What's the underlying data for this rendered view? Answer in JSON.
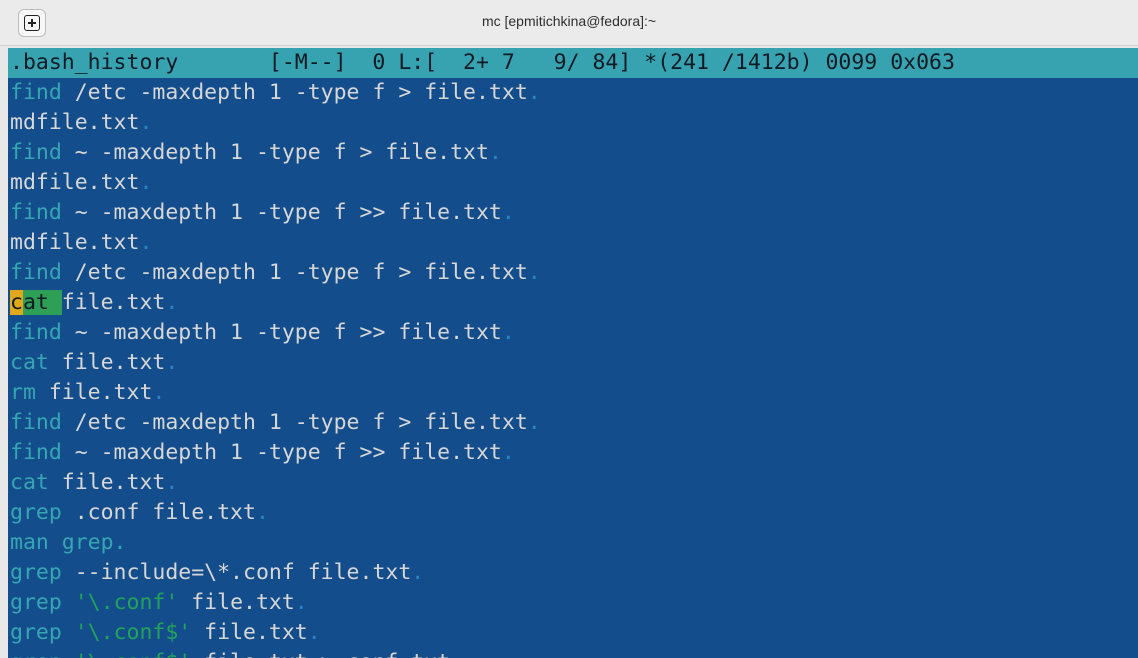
{
  "window": {
    "title": "mc [epmitichkina@fedora]:~",
    "new_tab_icon": "plus-square-icon"
  },
  "editor": {
    "status": ".bash_history       [-M--]  0 L:[  2+ 7   9/ 84] *(241 /1412b) 0099 0x063",
    "lines": [
      [
        {
          "t": "find",
          "c": "kw"
        },
        {
          "t": " /etc -maxdepth 1 -type f > file.txt",
          "c": ""
        },
        {
          "t": ".",
          "c": "eol"
        }
      ],
      [
        {
          "t": "mdfile.txt",
          "c": ""
        },
        {
          "t": ".",
          "c": "eol"
        }
      ],
      [
        {
          "t": "find",
          "c": "kw"
        },
        {
          "t": " ~ -maxdepth 1 -type f > file.txt",
          "c": ""
        },
        {
          "t": ".",
          "c": "eol"
        }
      ],
      [
        {
          "t": "mdfile.txt",
          "c": ""
        },
        {
          "t": ".",
          "c": "eol"
        }
      ],
      [
        {
          "t": "find",
          "c": "kw"
        },
        {
          "t": " ~ -maxdepth 1 -type f >> file.txt",
          "c": ""
        },
        {
          "t": ".",
          "c": "eol"
        }
      ],
      [
        {
          "t": "mdfile.txt",
          "c": ""
        },
        {
          "t": ".",
          "c": "eol"
        }
      ],
      [
        {
          "t": "find",
          "c": "kw"
        },
        {
          "t": " /etc -maxdepth 1 -type f > file.txt",
          "c": ""
        },
        {
          "t": ".",
          "c": "eol"
        }
      ],
      [
        {
          "t": "c",
          "c": "cursor-c"
        },
        {
          "t": "at ",
          "c": "sel"
        },
        {
          "t": "file.txt",
          "c": ""
        },
        {
          "t": ".",
          "c": "eol"
        }
      ],
      [
        {
          "t": "find",
          "c": "kw"
        },
        {
          "t": " ~ -maxdepth 1 -type f >> file.txt",
          "c": ""
        },
        {
          "t": ".",
          "c": "eol"
        }
      ],
      [
        {
          "t": "cat",
          "c": "kw"
        },
        {
          "t": " file.txt",
          "c": ""
        },
        {
          "t": ".",
          "c": "eol"
        }
      ],
      [
        {
          "t": "rm",
          "c": "kw"
        },
        {
          "t": " file.txt",
          "c": ""
        },
        {
          "t": ".",
          "c": "eol"
        }
      ],
      [
        {
          "t": "find",
          "c": "kw"
        },
        {
          "t": " /etc -maxdepth 1 -type f > file.txt",
          "c": ""
        },
        {
          "t": ".",
          "c": "eol"
        }
      ],
      [
        {
          "t": "find",
          "c": "kw"
        },
        {
          "t": " ~ -maxdepth 1 -type f >> file.txt",
          "c": ""
        },
        {
          "t": ".",
          "c": "eol"
        }
      ],
      [
        {
          "t": "cat",
          "c": "kw"
        },
        {
          "t": " file.txt",
          "c": ""
        },
        {
          "t": ".",
          "c": "eol"
        }
      ],
      [
        {
          "t": "grep",
          "c": "kw"
        },
        {
          "t": " .conf file.txt",
          "c": ""
        },
        {
          "t": ".",
          "c": "eol"
        }
      ],
      [
        {
          "t": "man grep.",
          "c": "kw"
        }
      ],
      [
        {
          "t": "grep",
          "c": "kw"
        },
        {
          "t": " --include=\\*.conf file.txt",
          "c": ""
        },
        {
          "t": ".",
          "c": "eol"
        }
      ],
      [
        {
          "t": "grep",
          "c": "kw"
        },
        {
          "t": " ",
          "c": ""
        },
        {
          "t": "'\\.conf'",
          "c": "str"
        },
        {
          "t": " file.txt",
          "c": ""
        },
        {
          "t": ".",
          "c": "eol"
        }
      ],
      [
        {
          "t": "grep",
          "c": "kw"
        },
        {
          "t": " ",
          "c": ""
        },
        {
          "t": "'\\.conf$'",
          "c": "str"
        },
        {
          "t": " file.txt",
          "c": ""
        },
        {
          "t": ".",
          "c": "eol"
        }
      ],
      [
        {
          "t": "grep",
          "c": "kw"
        },
        {
          "t": " ",
          "c": ""
        },
        {
          "t": "'\\.conf$'",
          "c": "str"
        },
        {
          "t": " file.txt > conf.txt",
          "c": ""
        },
        {
          "t": ".",
          "c": "eol"
        }
      ]
    ]
  }
}
